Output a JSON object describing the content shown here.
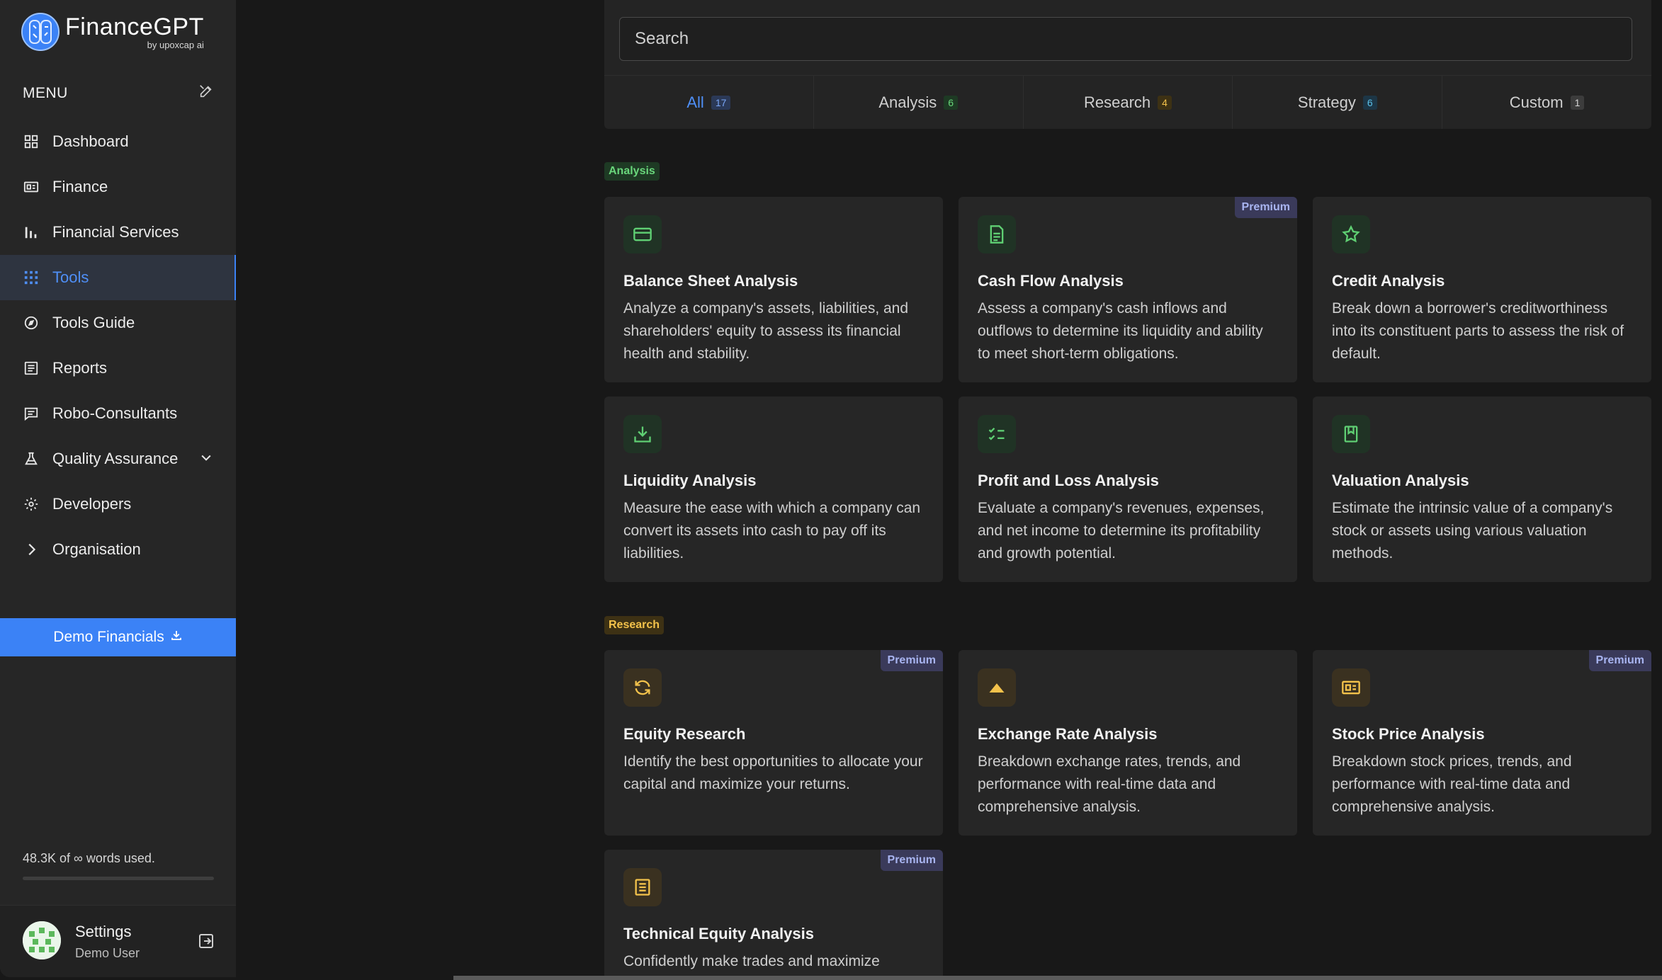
{
  "brand": {
    "name": "FinanceGPT",
    "byline": "by upoxcap ai",
    "primary_color": "#3b82f6"
  },
  "menu": {
    "label": "MENU",
    "items": [
      {
        "label": "Dashboard",
        "icon": "grid-icon"
      },
      {
        "label": "Finance",
        "icon": "id-card-icon"
      },
      {
        "label": "Financial Services",
        "icon": "bar-chart-icon"
      },
      {
        "label": "Tools",
        "icon": "dots-grid-icon",
        "active": true
      },
      {
        "label": "Tools Guide",
        "icon": "compass-icon"
      },
      {
        "label": "Reports",
        "icon": "report-icon"
      },
      {
        "label": "Robo-Consultants",
        "icon": "chat-icon"
      },
      {
        "label": "Quality Assurance",
        "icon": "flask-icon"
      },
      {
        "label": "Developers",
        "icon": "gear-icon"
      },
      {
        "label": "Organisation",
        "icon": "chevron-right-icon"
      }
    ]
  },
  "demo_button": {
    "label": "Demo Financials"
  },
  "usage": {
    "text": "48.3K of ∞ words used."
  },
  "user": {
    "name": "Settings",
    "role": "Demo User"
  },
  "search": {
    "placeholder": "Search"
  },
  "tabs": [
    {
      "label": "All",
      "count": "17",
      "active": true
    },
    {
      "label": "Analysis",
      "count": "6"
    },
    {
      "label": "Research",
      "count": "4"
    },
    {
      "label": "Strategy",
      "count": "6"
    },
    {
      "label": "Custom",
      "count": "1"
    }
  ],
  "sections": {
    "analysis": {
      "label": "Analysis",
      "cards": [
        {
          "title": "Balance Sheet Analysis",
          "desc": "Analyze a company's assets, liabilities, and shareholders' equity to assess its financial health and stability.",
          "icon": "credit-card-icon"
        },
        {
          "title": "Cash Flow Analysis",
          "desc": "Assess a company's cash inflows and outflows to determine its liquidity and ability to meet short-term obligations.",
          "icon": "document-icon",
          "premium": "Premium"
        },
        {
          "title": "Credit Analysis",
          "desc": "Break down a borrower's creditworthiness into its constituent parts to assess the risk of default.",
          "icon": "star-icon"
        },
        {
          "title": "Liquidity Analysis",
          "desc": "Measure the ease with which a company can convert its assets into cash to pay off its liabilities.",
          "icon": "download-tray-icon"
        },
        {
          "title": "Profit and Loss Analysis",
          "desc": "Evaluate a company's revenues, expenses, and net income to determine its profitability and growth potential.",
          "icon": "checklist-icon"
        },
        {
          "title": "Valuation Analysis",
          "desc": "Estimate the intrinsic value of a company's stock or assets using various valuation methods.",
          "icon": "bookmark-icon"
        }
      ]
    },
    "research": {
      "label": "Research",
      "cards": [
        {
          "title": "Equity Research",
          "desc": "Identify the best opportunities to allocate your capital and maximize your returns.",
          "icon": "refresh-icon",
          "premium": "Premium"
        },
        {
          "title": "Exchange Rate Analysis",
          "desc": "Breakdown exchange rates, trends, and performance with real-time data and comprehensive analysis.",
          "icon": "triangle-up-icon"
        },
        {
          "title": "Stock Price Analysis",
          "desc": "Breakdown stock prices, trends, and performance with real-time data and comprehensive analysis.",
          "icon": "id-card-icon",
          "premium": "Premium"
        },
        {
          "title": "Technical Equity Analysis",
          "desc": "Confidently make trades and maximize",
          "icon": "list-document-icon",
          "premium": "Premium"
        }
      ]
    }
  },
  "colors": {
    "analysis_accent": "#69d67b",
    "research_accent": "#f3c24b",
    "active_tab": "#4f8ff7"
  }
}
